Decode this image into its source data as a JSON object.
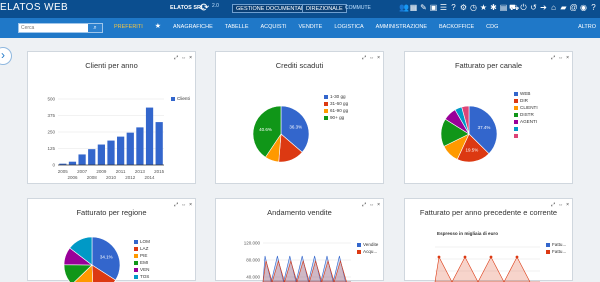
{
  "app": {
    "brand": "ELATOS WEB",
    "company": "ELATOS SRL",
    "version": "2.0",
    "doc": "GESTIONE DOCUMENTALE",
    "dir": "DIREZIONALE",
    "tiny": "COMMUTE"
  },
  "icons": [
    "users-icon",
    "calendar-icon",
    "pencil-icon",
    "clipboard-icon",
    "list-icon",
    "help-icon",
    "settings-icon",
    "clock-icon",
    "star-icon",
    "gear-icon",
    "grid-icon",
    "truck-icon",
    "power-icon",
    "history-icon",
    "arrow-icon",
    "home-icon",
    "folder-icon",
    "email-icon",
    "globe-icon",
    "help2-icon"
  ],
  "nav": {
    "search_placeholder": "Cerca",
    "items": [
      "PREFERITI",
      "ANAGRAFICHE",
      "TABELLE",
      "ACQUISTI",
      "VENDITE",
      "LOGISTICA",
      "AMMINISTRAZIONE",
      "BACKOFFICE",
      "CDG"
    ],
    "altro": "ALTRO"
  },
  "panels": {
    "clienti": {
      "title": "Clienti per anno"
    },
    "crediti": {
      "title": "Crediti scaduti"
    },
    "canale": {
      "title": "Fatturato per canale"
    },
    "regione": {
      "title": "Fatturato per regione"
    },
    "vendite": {
      "title": "Andamento vendite"
    },
    "anno": {
      "title": "Fatturato per anno precedente e corrente",
      "subtitle": "Espresso in migliaia di euro"
    }
  },
  "chart_data": [
    {
      "type": "bar",
      "title": "Clienti per anno",
      "categories": [
        "2005",
        "2006",
        "2007",
        "2008",
        "2009",
        "2010",
        "2011",
        "2012",
        "2013",
        "2014",
        "2015"
      ],
      "values": [
        10,
        25,
        80,
        120,
        155,
        185,
        215,
        245,
        285,
        435,
        325
      ],
      "series": [
        {
          "name": "Clienti",
          "values": [
            10,
            25,
            80,
            120,
            155,
            185,
            215,
            245,
            285,
            435,
            325
          ]
        }
      ],
      "ylim": [
        0,
        500
      ],
      "yticks": [
        0,
        125,
        250,
        375,
        500
      ],
      "color": "#3366cc"
    },
    {
      "type": "pie",
      "title": "Crediti scaduti",
      "labels": [
        "1-30 gg",
        "31-60 gg",
        "61-90 gg",
        "90+ gg"
      ],
      "values": [
        36.3,
        15.0,
        8.1,
        40.6
      ],
      "colors": [
        "#3366cc",
        "#dc3912",
        "#ff9900",
        "#109618"
      ],
      "label_text": [
        "36.3%",
        "",
        "",
        "40.6%"
      ]
    },
    {
      "type": "pie",
      "title": "Fatturato per canale",
      "labels": [
        "WEB",
        "DIR",
        "CLIENTI",
        "DISTR",
        "AGENTI",
        "",
        ""
      ],
      "values": [
        37.4,
        19.5,
        10.8,
        16.2,
        7.8,
        4.1,
        4.2
      ],
      "colors": [
        "#3366cc",
        "#dc3912",
        "#ff9900",
        "#109618",
        "#990099",
        "#0099c6",
        "#dd4477"
      ],
      "label_text": [
        "37.4%",
        "19.5%",
        "",
        "",
        "",
        "",
        ""
      ]
    },
    {
      "type": "pie",
      "title": "Fatturato per regione",
      "labels": [
        "LOM",
        "LAZ",
        "PIE",
        "EMI",
        "VEN",
        "TOS"
      ],
      "values": [
        34.1,
        15.2,
        13.5,
        12.4,
        10.2,
        14.6
      ],
      "colors": [
        "#3366cc",
        "#dc3912",
        "#ff9900",
        "#109618",
        "#990099",
        "#0099c6"
      ],
      "label_text": [
        "34.1%",
        "",
        "",
        "",
        "",
        ""
      ]
    },
    {
      "type": "area",
      "title": "Andamento vendite",
      "series": [
        {
          "name": "Vendite",
          "color": "#3366cc"
        },
        {
          "name": "Acqu...",
          "color": "#dc3912"
        }
      ],
      "yticks": [
        0,
        40000,
        80000,
        120000
      ],
      "tick_labels": [
        "",
        "40.000",
        "80.000",
        "120.000"
      ]
    },
    {
      "type": "line",
      "title": "Fatturato per anno precedente e corrente",
      "subtitle": "Espresso in migliaia di euro",
      "series": [
        {
          "name": "Fattu...",
          "color": "#3366cc"
        },
        {
          "name": "Fattu...",
          "color": "#dc3912"
        }
      ]
    }
  ]
}
